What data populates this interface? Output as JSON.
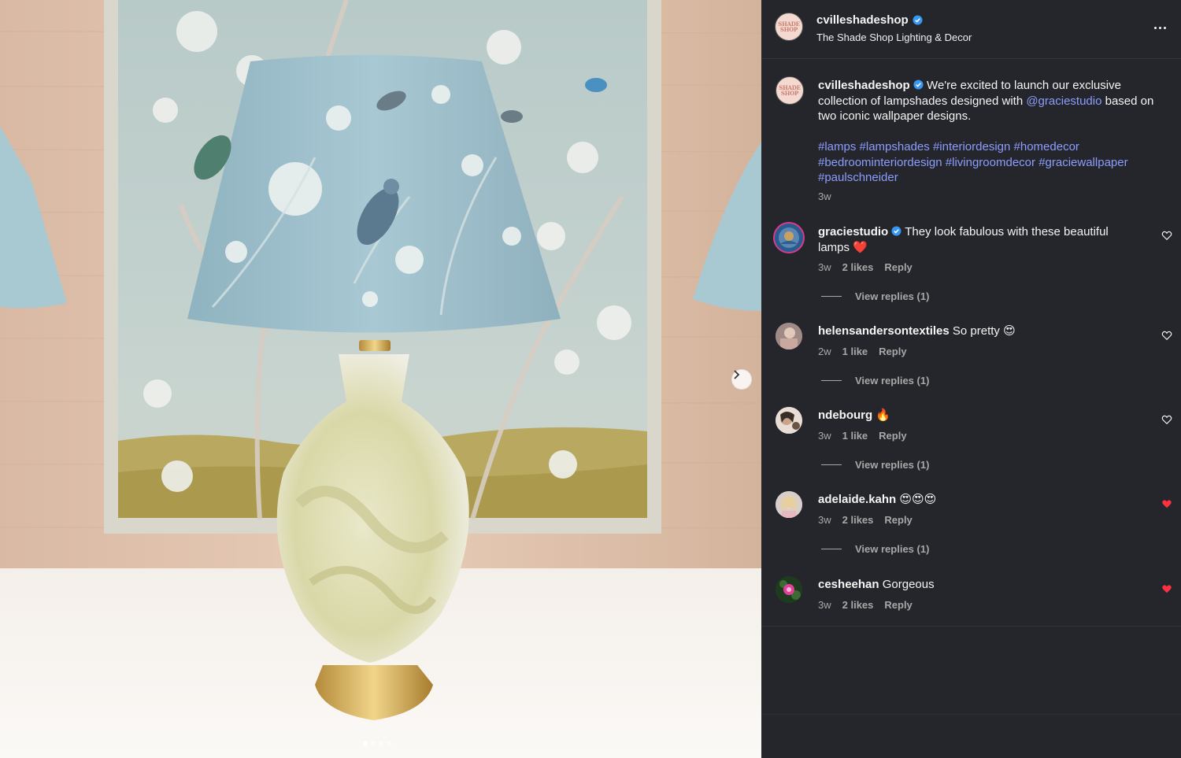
{
  "post": {
    "username": "cvilleshadeshop",
    "subtitle": "The Shade Shop Lighting & Decor",
    "avatar_lines": [
      "SHADE",
      "SHOP"
    ],
    "caption_text": " We're excited to launch our exclusive collection of lampshades designed with ",
    "caption_mention": "@graciestudio",
    "caption_end": " based on two iconic wallpaper designs.",
    "hashtags": [
      "#lamps",
      "#lampshades",
      "#interiordesign",
      "#homedecor",
      "#bedroominteriordesign",
      "#livingroomdecor",
      "#graciewallpaper",
      "#paulschneider"
    ],
    "time": "3w",
    "carousel_dots": 4
  },
  "colors": {
    "panel_bg": "#25262b",
    "link": "#8b9dff",
    "verified": "#3897f0",
    "liked": "#ff3040",
    "muted": "#a8a8a8"
  },
  "comments": [
    {
      "username": "graciestudio",
      "verified": true,
      "text": "They look fabulous with these beautiful lamps ❤️",
      "time": "3w",
      "likes": "2 likes",
      "reply": "Reply",
      "view_replies": "View replies (1)",
      "liked": false
    },
    {
      "username": "helensandersontextiles",
      "verified": false,
      "text": "So pretty 😍",
      "time": "2w",
      "likes": "1 like",
      "reply": "Reply",
      "view_replies": "View replies (1)",
      "liked": false
    },
    {
      "username": "ndebourg",
      "verified": false,
      "text": "🔥",
      "time": "3w",
      "likes": "1 like",
      "reply": "Reply",
      "view_replies": "View replies (1)",
      "liked": false
    },
    {
      "username": "adelaide.kahn",
      "verified": false,
      "text": "😍😍😍",
      "time": "3w",
      "likes": "2 likes",
      "reply": "Reply",
      "view_replies": "View replies (1)",
      "liked": true
    },
    {
      "username": "cesheehan",
      "verified": false,
      "text": "Gorgeous",
      "time": "3w",
      "likes": "2 likes",
      "reply": "Reply",
      "view_replies": "",
      "liked": true
    }
  ]
}
